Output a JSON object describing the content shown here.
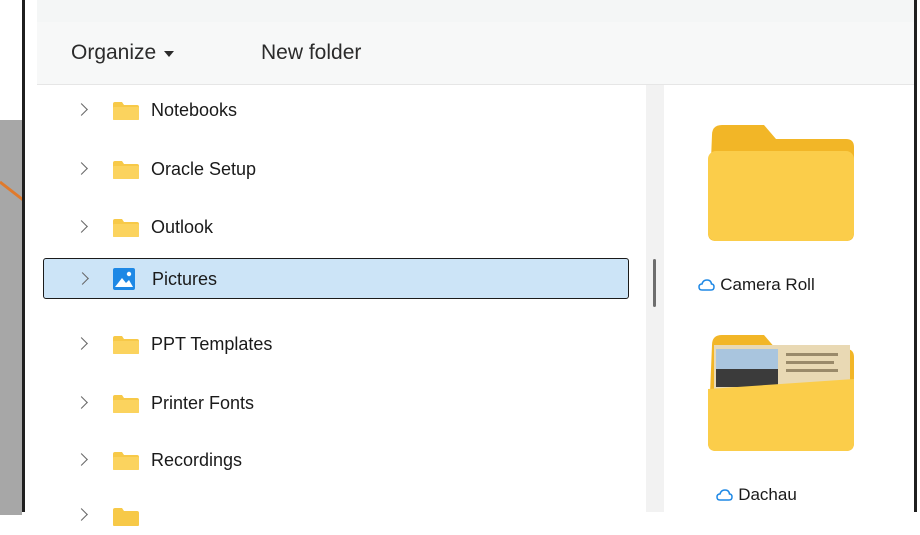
{
  "toolbar": {
    "organize_label": "Organize",
    "new_folder_label": "New folder"
  },
  "nav_items": [
    {
      "label": "Notebooks",
      "icon": "folder-icon"
    },
    {
      "label": "Oracle Setup",
      "icon": "folder-icon"
    },
    {
      "label": "Outlook",
      "icon": "folder-icon"
    },
    {
      "label": "Pictures",
      "icon": "pictures-icon",
      "selected": true
    },
    {
      "label": "PPT Templates",
      "icon": "folder-icon"
    },
    {
      "label": "Printer Fonts",
      "icon": "folder-icon"
    },
    {
      "label": "Recordings",
      "icon": "folder-icon"
    }
  ],
  "content_items": [
    {
      "label": "Camera Roll",
      "icon": "cloud-icon"
    },
    {
      "label": "Dachau",
      "icon": "cloud-icon"
    }
  ],
  "colors": {
    "selection": "#cce4f7",
    "folder": "#f7c948",
    "annotation_arrow": "#e07a2c"
  }
}
